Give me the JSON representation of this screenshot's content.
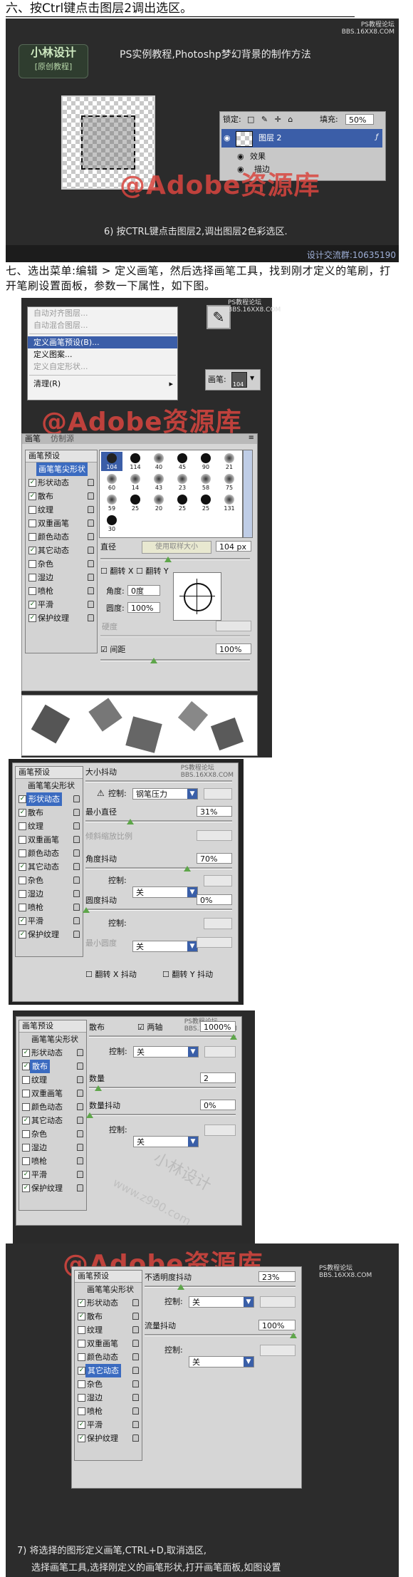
{
  "step6": {
    "title": "六、按Ctrl键点击图层2调出选区。",
    "logo_main": "小林设计",
    "logo_sub": "[原创教程]",
    "site_stamp_1": "PS教程论坛",
    "site_stamp_2": "BBS.16XX8.COM",
    "heading": "PS实例教程,Photoshp梦幻背景的制作方法",
    "layers_panel": {
      "lock_label": "锁定:",
      "fill_label": "填充:",
      "fill_value": "50%",
      "layer_name": "图层 2",
      "effects_label": "效果",
      "effect_item": "描边"
    },
    "watermark": "@Adobe资源库",
    "caption": "6) 按CTRL键点击图层2,调出图层2色彩选区.",
    "footer": "设计交流群:10635190"
  },
  "step7": {
    "paragraph": "七、选出菜单:编辑 > 定义画笔，然后选择画笔工具，找到刚才定义的笔刷，打开笔刷设置面板，参数一下属性，如下图。",
    "menu": {
      "items": [
        "自动对齐图层...",
        "自动混合图层...",
        "定义画笔预设(B)...",
        "定义图案...",
        "定义自定形状...",
        "清理(R)"
      ],
      "highlighted_index": 2
    },
    "brush_label": "画笔:",
    "brush_size": "104",
    "stamp_1": "PS教程论坛",
    "stamp_2": "BBS.16XX8.COM",
    "watermark": "@Adobe资源库"
  },
  "brush_panel_main": {
    "tabs": [
      "画笔",
      "仿制源"
    ],
    "sidebar": {
      "head": "画笔预设",
      "items": [
        {
          "label": "画笔笔尖形状",
          "checked": false,
          "selected": true
        },
        {
          "label": "形状动态",
          "checked": true
        },
        {
          "label": "散布",
          "checked": true
        },
        {
          "label": "纹理",
          "checked": false
        },
        {
          "label": "双重画笔",
          "checked": false
        },
        {
          "label": "颜色动态",
          "checked": false
        },
        {
          "label": "其它动态",
          "checked": true
        },
        {
          "label": "杂色",
          "checked": false
        },
        {
          "label": "湿边",
          "checked": false
        },
        {
          "label": "喷枪",
          "checked": false
        },
        {
          "label": "平滑",
          "checked": true
        },
        {
          "label": "保护纹理",
          "checked": true
        }
      ]
    },
    "tip_sizes": [
      "104",
      "114",
      "40",
      "45",
      "90",
      "21",
      "60",
      "14",
      "43",
      "23",
      "58",
      "75",
      "59",
      "25",
      "20",
      "25",
      "25",
      "131",
      "30"
    ],
    "diameter_label": "直径",
    "sample_button": "使用取样大小",
    "diameter_value": "104 px",
    "flip_x": "翻转 X",
    "flip_y": "翻转 Y",
    "angle_label": "角度:",
    "angle_value": "0度",
    "roundness_label": "圆度:",
    "roundness_value": "100%",
    "hardness_label": "硬度",
    "spacing_label": "间距",
    "spacing_value": "100%"
  },
  "shape_dynamics": {
    "stamp_1": "PS教程论坛",
    "stamp_2": "BBS.16XX8.COM",
    "size_jitter_label": "大小抖动",
    "control_label": "控制:",
    "control_value": "钢笔压力",
    "min_diameter_label": "最小直径",
    "min_diameter_value": "31%",
    "tilt_scale_label": "倾斜缩放比例",
    "angle_jitter_label": "角度抖动",
    "angle_jitter_value": "70%",
    "control2_value": "关",
    "roundness_jitter_label": "圆度抖动",
    "roundness_jitter_value": "0%",
    "control3_value": "关",
    "min_roundness_label": "最小圆度",
    "flip_x_jitter": "翻转 X 抖动",
    "flip_y_jitter": "翻转 Y 抖动",
    "watermark_faint": "小林设计"
  },
  "scattering": {
    "stamp_1": "PS教程论坛",
    "stamp_2": "BBS.16XX8.COM",
    "scatter_label": "散布",
    "both_axes": "两轴",
    "scatter_value": "1000%",
    "control_label": "控制:",
    "control_value": "关",
    "count_label": "数量",
    "count_value": "2",
    "count_jitter_label": "数量抖动",
    "count_jitter_value": "0%",
    "control2_value": "关",
    "watermark_faint": "小林设计",
    "watermark_url": "www.z990.com"
  },
  "other_dynamics": {
    "watermark": "@Adobe资源库",
    "stamp_1": "PS教程论坛",
    "stamp_2": "BBS.16XX8.COM",
    "opacity_jitter_label": "不透明度抖动",
    "opacity_jitter_value": "23%",
    "control_label": "控制:",
    "control_value": "关",
    "flow_jitter_label": "流量抖动",
    "flow_jitter_value": "100%",
    "control2_value": "关",
    "caption_line1": "7) 将选择的图形定义画笔,CTRL+D,取消选区,",
    "caption_line2": "选择画笔工具,选择刚定义的画笔形状,打开画笔面板,如图设置"
  },
  "colors": {
    "panel_dark": "#2b2b2b",
    "watermark_red": "#d9463f",
    "highlight_blue": "#3b6bc0",
    "slider_green": "#5ea64a"
  }
}
